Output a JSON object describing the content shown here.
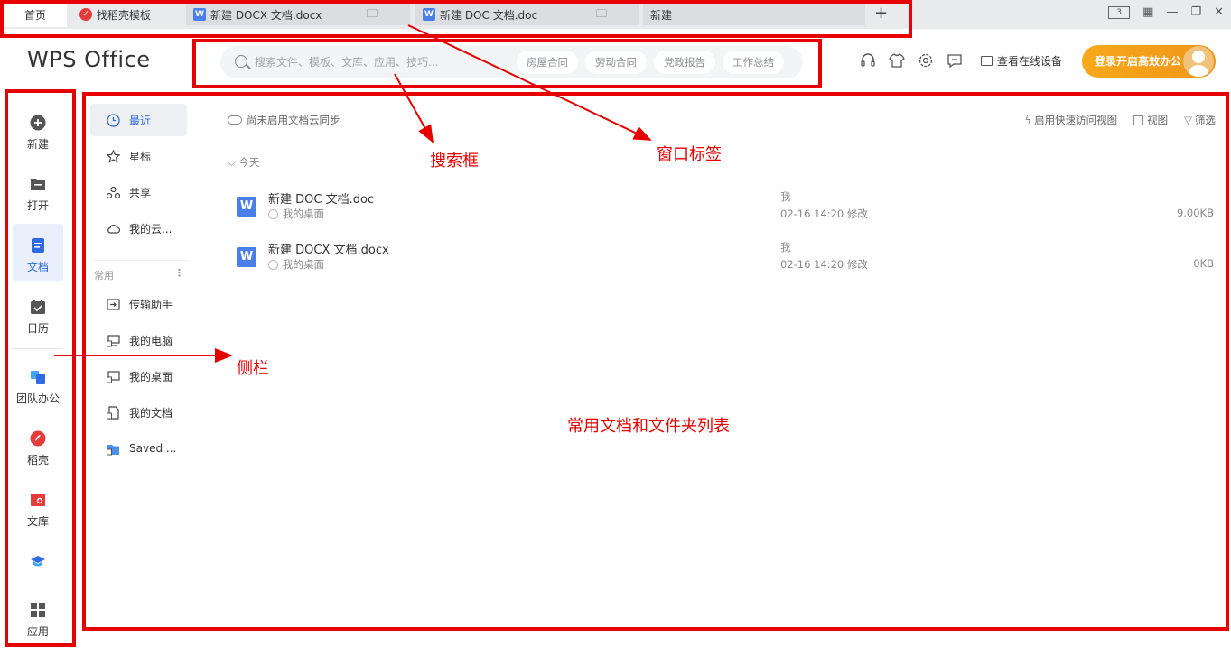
{
  "tabs": {
    "home": "首页",
    "items": [
      {
        "label": "找稻壳模板",
        "icon": "daoke-icon"
      },
      {
        "label": "新建 DOCX 文档.docx",
        "icon": "wps-writer-icon"
      },
      {
        "label": "新建 DOC 文档.doc",
        "icon": "wps-writer-icon"
      },
      {
        "label": "新建",
        "icon": ""
      }
    ],
    "add": "+",
    "layout_badge": "3"
  },
  "header": {
    "logo": "WPS Office",
    "search_placeholder": "搜索文件、模板、文库、应用、技巧...",
    "chips": [
      "房屋合同",
      "劳动合同",
      "党政报告",
      "工作总结"
    ],
    "device_link": "查看在线设备",
    "login_button": "登录开启高效办公"
  },
  "leftnav": [
    {
      "label": "新建",
      "icon": "plus-circle-icon"
    },
    {
      "label": "打开",
      "icon": "folder-icon"
    },
    {
      "label": "文档",
      "icon": "document-icon",
      "active": true
    },
    {
      "label": "日历",
      "icon": "calendar-icon"
    },
    {
      "label": "团队办公",
      "icon": "team-icon"
    },
    {
      "label": "稻壳",
      "icon": "daoke-icon"
    },
    {
      "label": "文库",
      "icon": "library-icon"
    },
    {
      "label": "",
      "icon": "hat-icon"
    },
    {
      "label": "应用",
      "icon": "apps-grid-icon"
    }
  ],
  "subnav": {
    "items": [
      {
        "label": "最近",
        "icon": "clock-icon",
        "active": true
      },
      {
        "label": "星标",
        "icon": "star-icon"
      },
      {
        "label": "共享",
        "icon": "share-icon"
      },
      {
        "label": "我的云...",
        "icon": "cloud-icon"
      }
    ],
    "group_label": "常用",
    "group_more": "⋮",
    "places": [
      {
        "label": "传输助手",
        "icon": "transfer-icon"
      },
      {
        "label": "我的电脑",
        "icon": "computer-icon"
      },
      {
        "label": "我的桌面",
        "icon": "desktop-icon"
      },
      {
        "label": "我的文档",
        "icon": "mydocs-icon"
      },
      {
        "label": "Saved ...",
        "icon": "folder-icon"
      }
    ]
  },
  "main": {
    "cloud_sync": "尚未启用文档云同步",
    "tools": [
      "启用快速访问视图",
      "视图",
      "筛选"
    ],
    "section": "今天",
    "files": [
      {
        "name": "新建 DOC 文档.doc",
        "location": "我的桌面",
        "owner": "我",
        "time": "02-16 14:20 修改",
        "size": "9.00KB"
      },
      {
        "name": "新建 DOCX 文档.docx",
        "location": "我的桌面",
        "owner": "我",
        "time": "02-16 14:20 修改",
        "size": "0KB"
      }
    ]
  },
  "annotations": {
    "search": "搜索框",
    "tabs": "窗口标签",
    "sidebar": "侧栏",
    "list": "常用文档和文件夹列表"
  },
  "colors": {
    "accent": "#2f6ae0",
    "annotation": "#e60000",
    "login": "#f7a91a"
  }
}
